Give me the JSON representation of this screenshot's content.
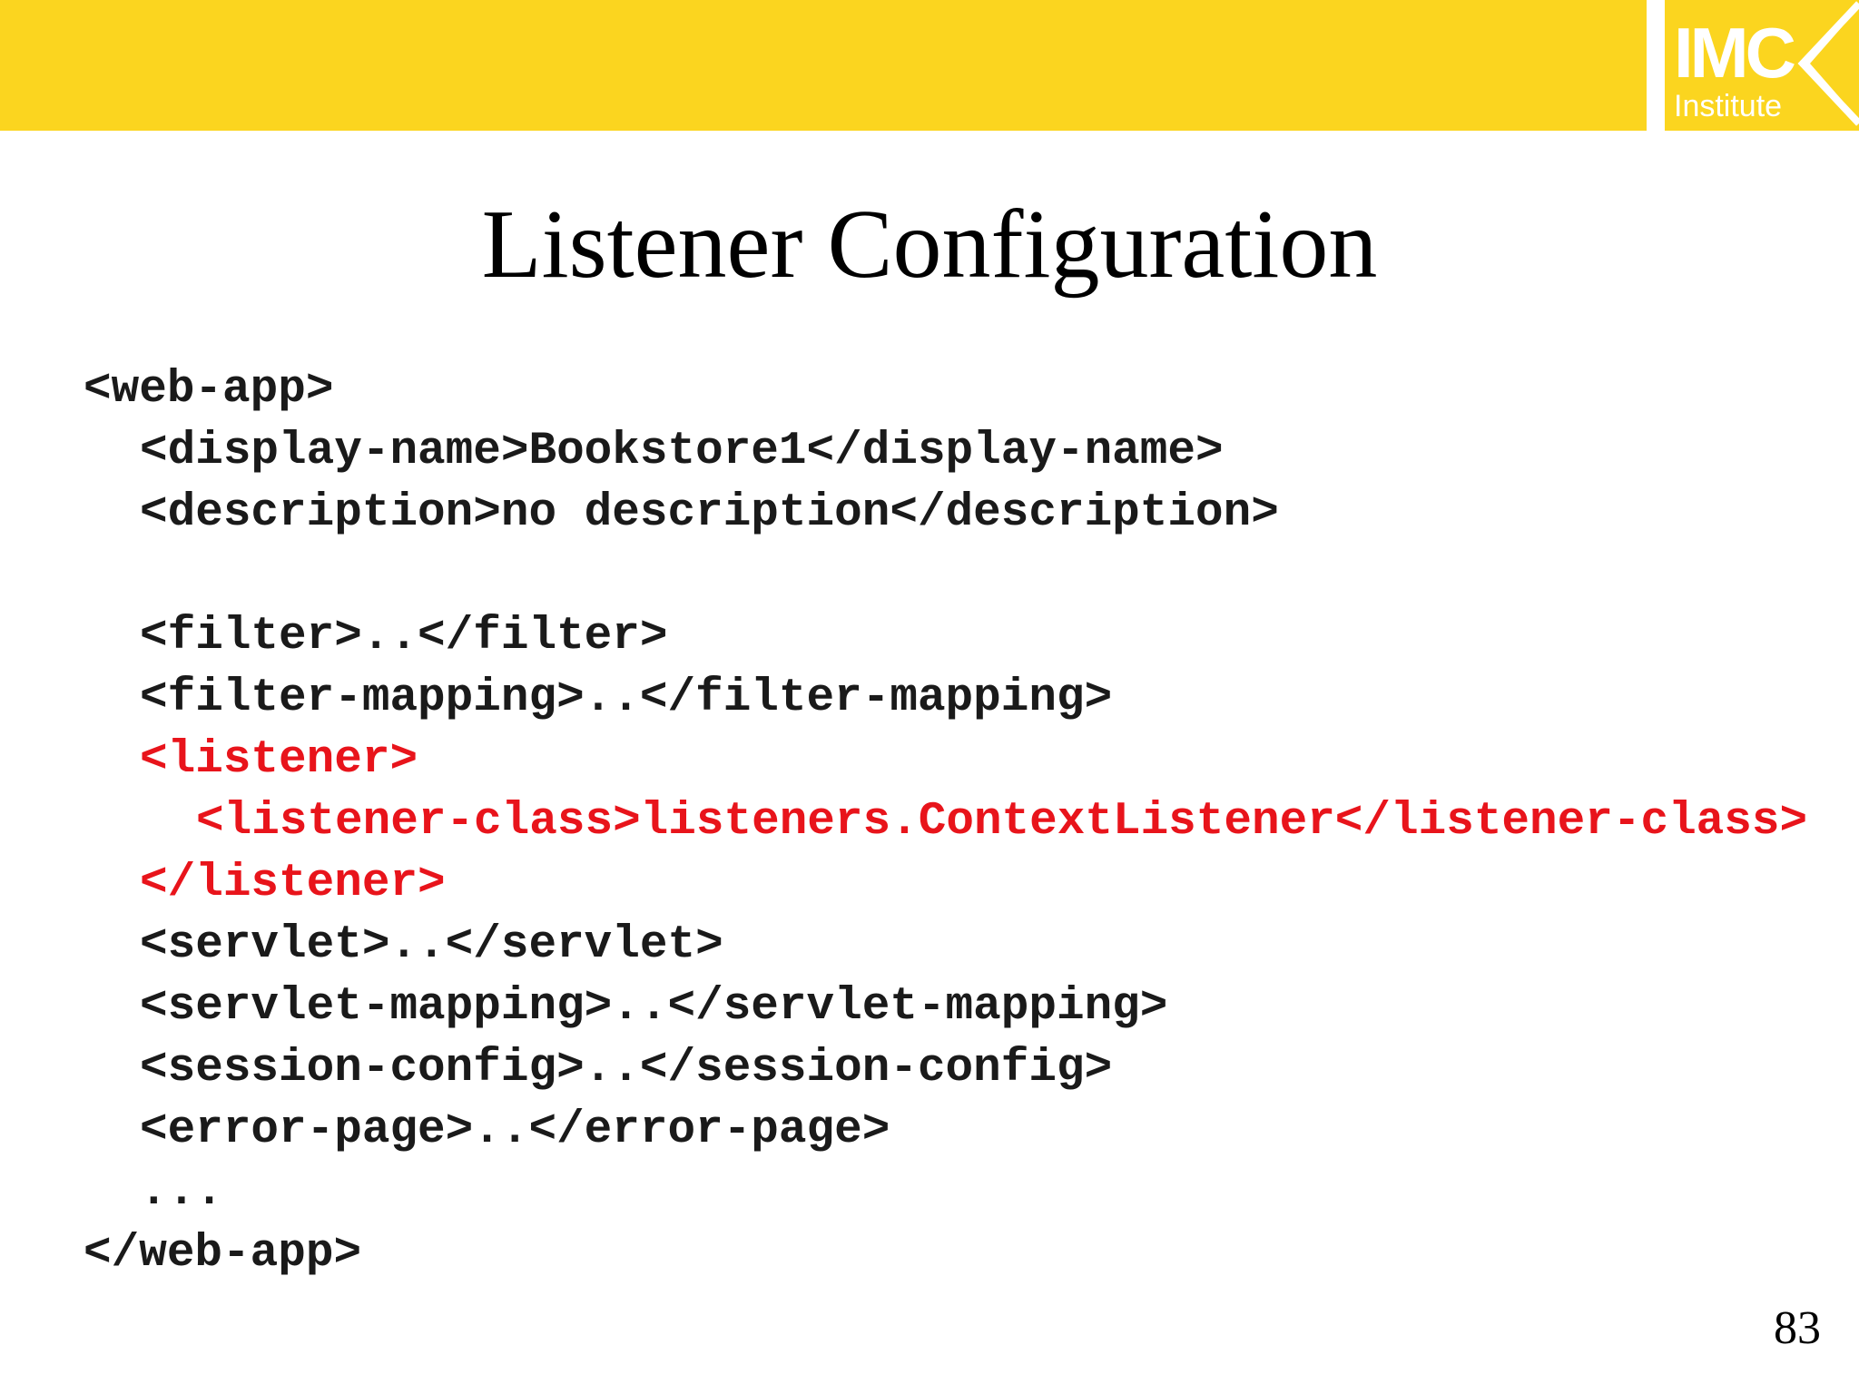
{
  "header": {
    "band_color": "#fbd51f",
    "logo": {
      "main_text": "IMC",
      "sub_text": "Institute"
    }
  },
  "title": "Listener Configuration",
  "code_lines": [
    {
      "text": "<web-app>",
      "indent": 0,
      "highlight": false
    },
    {
      "text": "<display-name>Bookstore1</display-name>",
      "indent": 1,
      "highlight": false
    },
    {
      "text": "<description>no description</description>",
      "indent": 1,
      "highlight": false
    },
    {
      "text": "",
      "indent": 1,
      "highlight": false
    },
    {
      "text": "<filter>..</filter>",
      "indent": 1,
      "highlight": false
    },
    {
      "text": "<filter-mapping>..</filter-mapping>",
      "indent": 1,
      "highlight": false
    },
    {
      "text": "<listener>",
      "indent": 1,
      "highlight": true
    },
    {
      "text": "<listener-class>listeners.ContextListener</listener-class>",
      "indent": 2,
      "highlight": true
    },
    {
      "text": "</listener>",
      "indent": 1,
      "highlight": true
    },
    {
      "text": "<servlet>..</servlet>",
      "indent": 1,
      "highlight": false
    },
    {
      "text": "<servlet-mapping>..</servlet-mapping>",
      "indent": 1,
      "highlight": false
    },
    {
      "text": "<session-config>..</session-config>",
      "indent": 1,
      "highlight": false
    },
    {
      "text": "<error-page>..</error-page>",
      "indent": 1,
      "highlight": false
    },
    {
      "text": "...",
      "indent": 1,
      "highlight": false
    },
    {
      "text": "</web-app>",
      "indent": 0,
      "highlight": false
    }
  ],
  "highlight_color": "#e8141b",
  "page_number": "83"
}
